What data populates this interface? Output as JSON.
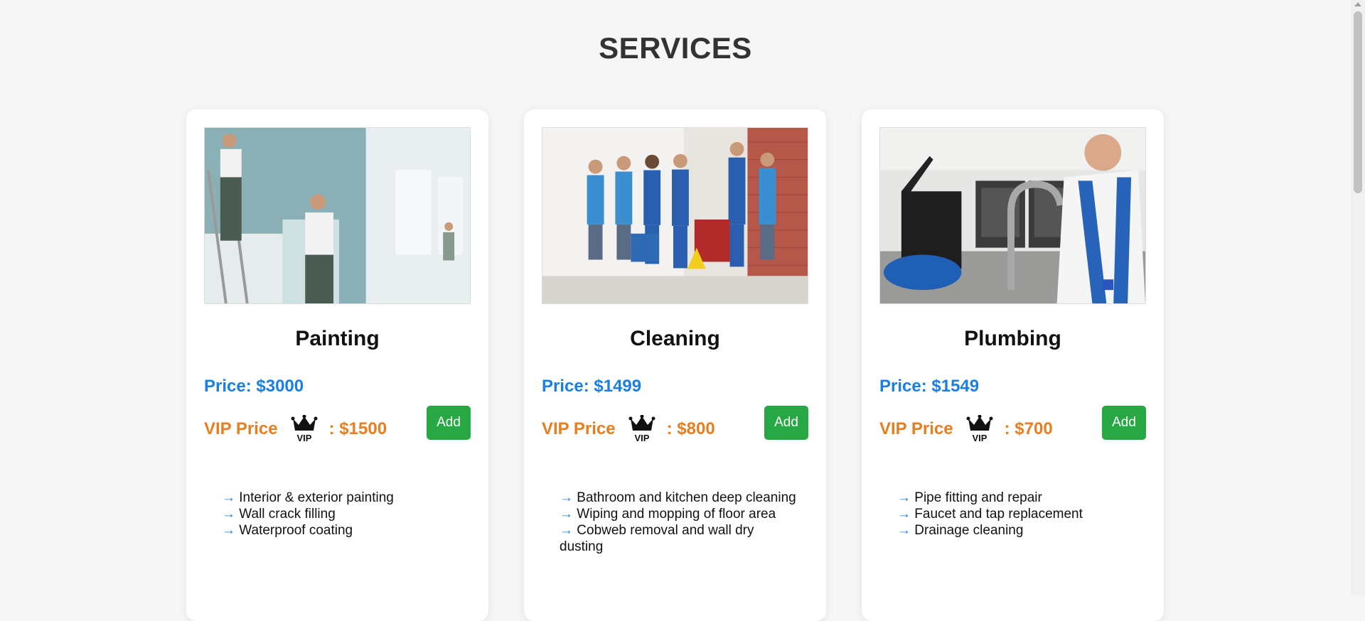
{
  "page": {
    "title": "SERVICES"
  },
  "cards": [
    {
      "name": "Painting",
      "price": "Price: $3000",
      "vip_label": "VIP Price",
      "vip_price": ": $1500",
      "add_label": "Add",
      "image_icon": "painting-photo",
      "features": [
        {
          "arrow": "→",
          "text": "Interior & exterior painting"
        },
        {
          "arrow": "→",
          "text": "Wall crack filling"
        },
        {
          "arrow": "→",
          "text": "Waterproof coating"
        }
      ]
    },
    {
      "name": "Cleaning",
      "price": "Price: $1499",
      "vip_label": "VIP Price",
      "vip_price": ": $800",
      "add_label": "Add",
      "image_icon": "cleaning-photo",
      "features": [
        {
          "arrow": "→",
          "text": "Bathroom and kitchen deep cleaning"
        },
        {
          "arrow": "→",
          "text": "Wiping and mopping of floor area"
        },
        {
          "arrow": "→",
          "text": "Cobweb removal and wall dry dusting"
        }
      ]
    },
    {
      "name": "Plumbing",
      "price": "Price: $1549",
      "vip_label": "VIP Price",
      "vip_price": ": $700",
      "add_label": "Add",
      "image_icon": "plumbing-photo",
      "features": [
        {
          "arrow": "→",
          "text": "Pipe fitting and repair"
        },
        {
          "arrow": "→",
          "text": "Faucet and tap replacement"
        },
        {
          "arrow": "→",
          "text": "Drainage cleaning"
        }
      ]
    }
  ],
  "crown_icon": {
    "text": "VIP"
  },
  "colors": {
    "price": "#1a7fe0",
    "vip": "#e67e22",
    "add_button": "#28a745",
    "background": "#f6f6f6"
  }
}
